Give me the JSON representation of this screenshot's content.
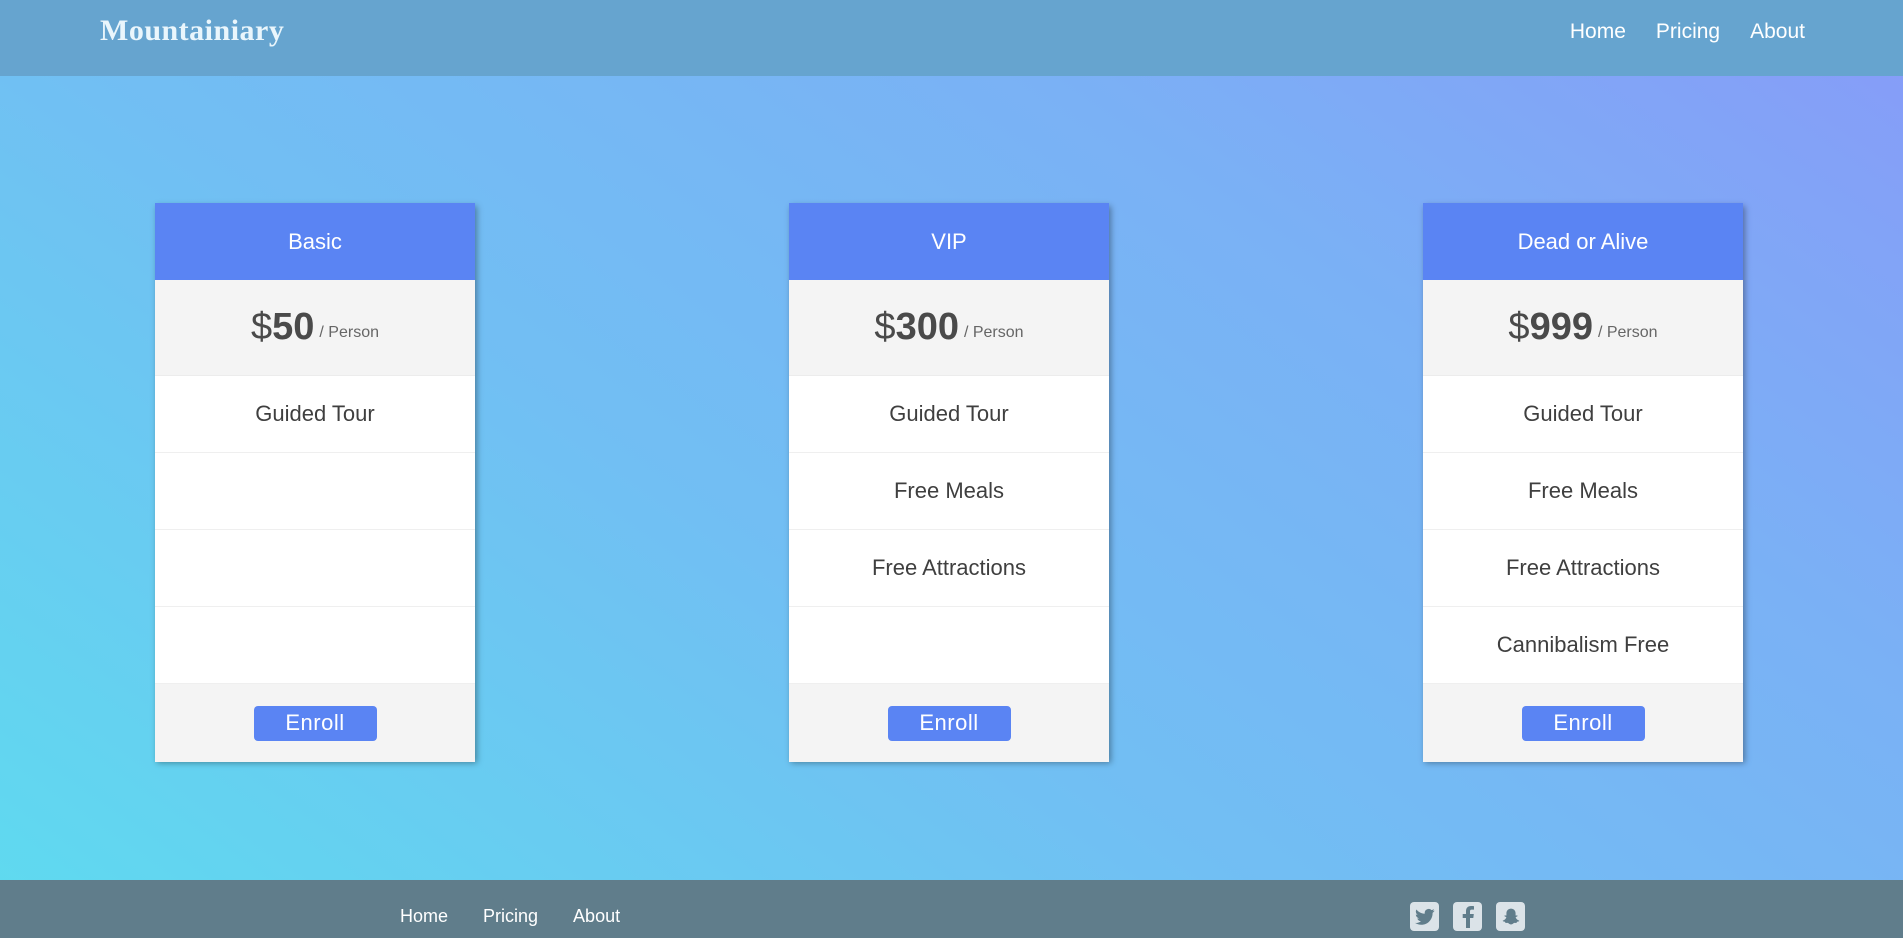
{
  "brand": "Mountainiary",
  "nav": [
    {
      "label": "Home"
    },
    {
      "label": "Pricing"
    },
    {
      "label": "About"
    }
  ],
  "plans": [
    {
      "name": "Basic",
      "currency": "$",
      "price": "50",
      "unit": "/ Person",
      "features": [
        "Guided Tour",
        "",
        "",
        ""
      ],
      "button": "Enroll"
    },
    {
      "name": "VIP",
      "currency": "$",
      "price": "300",
      "unit": "/ Person",
      "features": [
        "Guided Tour",
        "Free Meals",
        "Free Attractions",
        ""
      ],
      "button": "Enroll"
    },
    {
      "name": "Dead or Alive",
      "currency": "$",
      "price": "999",
      "unit": "/ Person",
      "features": [
        "Guided Tour",
        "Free Meals",
        "Free Attractions",
        "Cannibalism Free"
      ],
      "button": "Enroll"
    }
  ],
  "footer": {
    "nav": [
      {
        "label": "Home"
      },
      {
        "label": "Pricing"
      },
      {
        "label": "About"
      }
    ],
    "social": [
      {
        "icon": "twitter-icon"
      },
      {
        "icon": "facebook-icon"
      },
      {
        "icon": "snapchat-icon"
      }
    ]
  },
  "colors": {
    "header": "#66a4cf",
    "accent": "#5a84f3",
    "footer": "#607d8b"
  }
}
